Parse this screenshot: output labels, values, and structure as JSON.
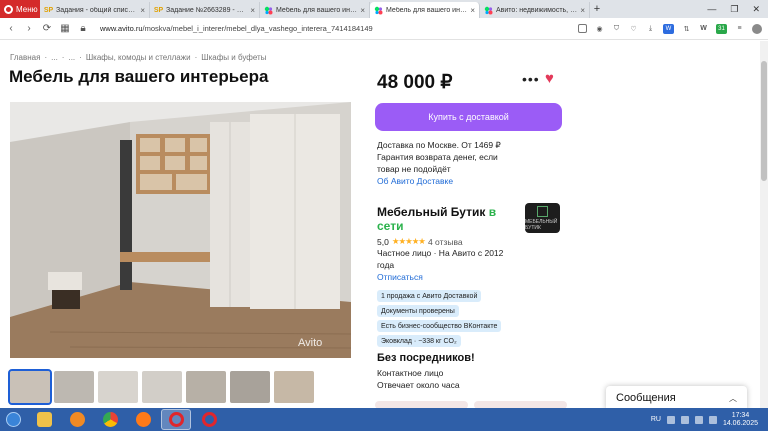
{
  "browser": {
    "menu_label": "Меню",
    "tabs": [
      {
        "favicon": "SP",
        "title": "Задания - общий список ...",
        "active": false
      },
      {
        "favicon": "SP",
        "title": "Задание №2663289 - про...",
        "active": false
      },
      {
        "favicon": "avito",
        "title": "Мебель для вашего интер...",
        "active": false
      },
      {
        "favicon": "avito",
        "title": "Мебель для вашего интер...",
        "active": true
      },
      {
        "favicon": "avito",
        "title": "Авито: недвижимость, тр...",
        "active": false
      }
    ],
    "url_host": "www.avito.ru",
    "url_path": "/moskva/mebel_i_interer/mebel_dlya_vashego_interera_7414184149",
    "ext_badge_count": "31"
  },
  "listing": {
    "breadcrumbs": [
      "Главная",
      "·",
      "...",
      "·",
      "...",
      "·",
      "Шкафы, комоды и стеллажи",
      "·",
      "Шкафы и буфеты"
    ],
    "title": "Мебель для вашего интерьера",
    "price": "48 000 ₽",
    "photo_watermark": "Avito",
    "buy_button": "Купить с доставкой",
    "delivery_line1": "Доставка по Москве. От 1469 ₽",
    "delivery_line2": "Гарантия возврата денег, если товар не подойдёт",
    "delivery_link": "Об Авито Доставке",
    "thumbnail_count": 7
  },
  "seller": {
    "name": "Мебельный Бутик",
    "online": "в сети",
    "logo_text": "МЕБЕЛЬНЫЙ БУТИК",
    "rating": "5,0",
    "stars": "★★★★★",
    "reviews": "4 отзыва",
    "type": "Частное лицо · На Авито с 2012 года",
    "unsubscribe": "Отписаться",
    "tags": [
      "1 продажа с Авито Доставкой",
      "Документы проверены",
      "Есть бизнес-сообщество ВКонтакте",
      "Эковклад · −338 кг CO₂"
    ]
  },
  "contact": {
    "heading": "Без посредников!",
    "method": "Контактное лицо",
    "response": "Отвечает около часа"
  },
  "messages": {
    "label": "Сообщения"
  },
  "taskbar": {
    "lang": "RU",
    "time": "17:34",
    "date": "14.06.2025"
  },
  "colors": {
    "accent": "#9b5cf6",
    "link": "#1e6ad6",
    "online": "#2bb24c",
    "heart": "#e33a5a",
    "tag_bg": "#d9ecfb",
    "taskbar": "#2f5fa8"
  }
}
